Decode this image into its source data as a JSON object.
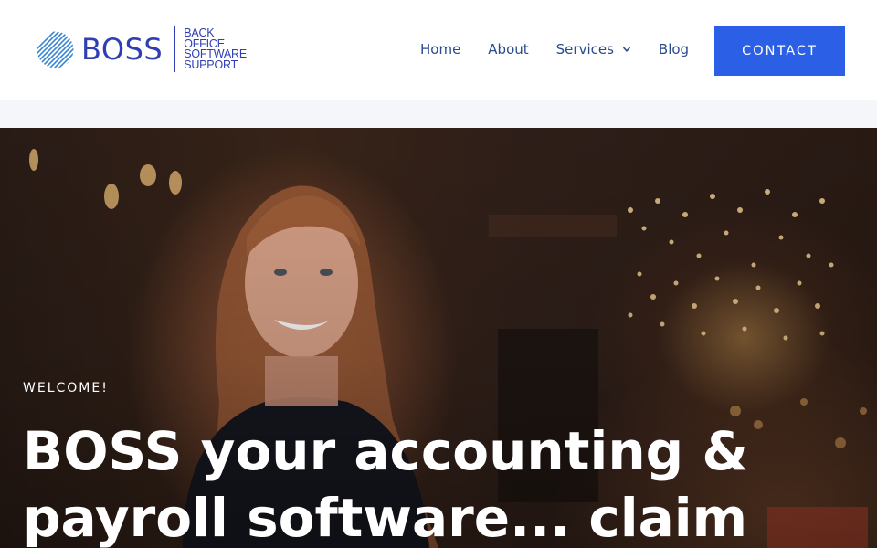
{
  "brand": {
    "wordmark": "BOSS",
    "tagline": [
      "BACK",
      "OFFICE",
      "SOFTWARE",
      "SUPPORT"
    ],
    "logo_icon": "striped-globe-icon",
    "color": "#2f3fb3"
  },
  "nav": {
    "items": [
      {
        "label": "Home"
      },
      {
        "label": "About"
      },
      {
        "label": "Services",
        "icon": "chevron-down-icon"
      },
      {
        "label": "Blog"
      }
    ],
    "contact_label": "CONTACT",
    "link_color": "#2a4c8a",
    "accent": "#2a5fe6"
  },
  "hero": {
    "eyebrow": "WELCOME!",
    "headline": "BOSS your accounting & payroll software... claim"
  }
}
